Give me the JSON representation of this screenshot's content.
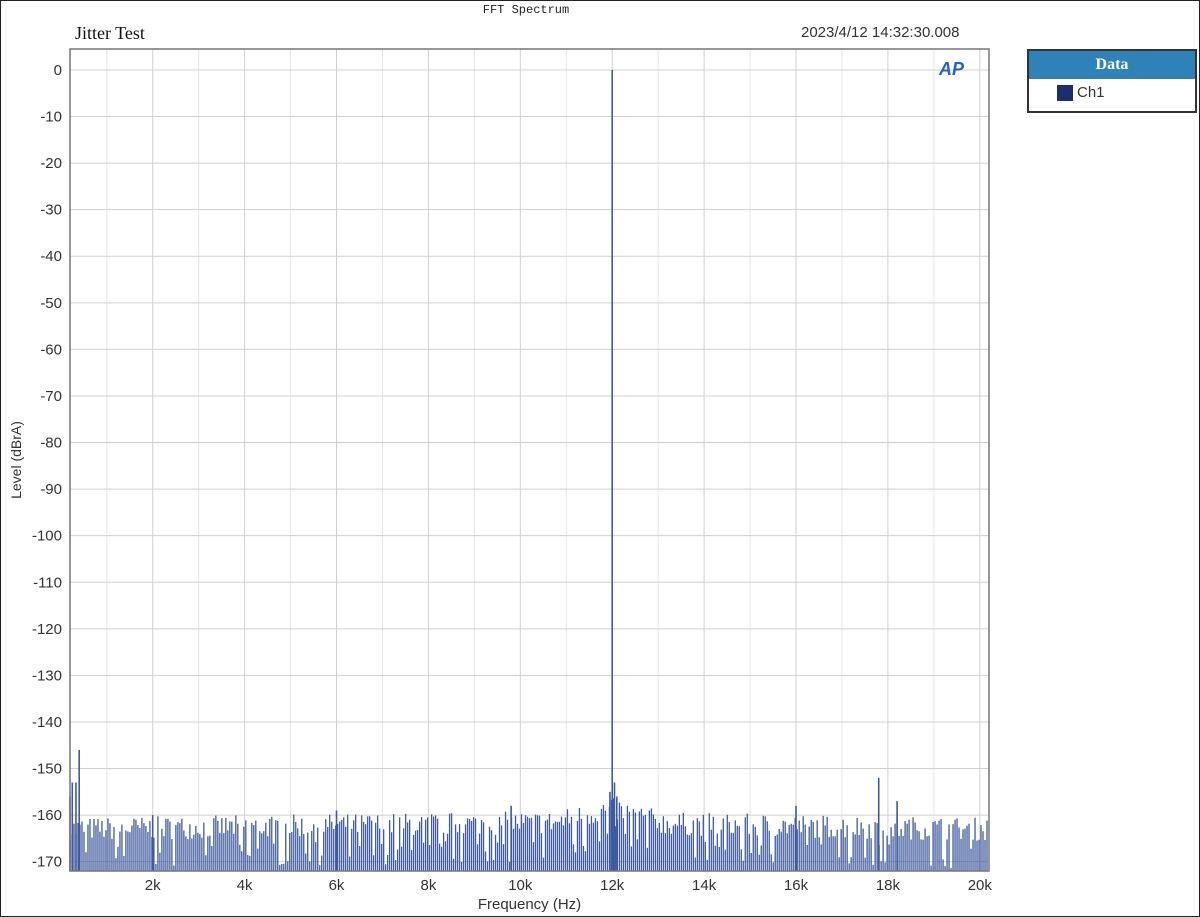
{
  "chart_data": {
    "type": "bar",
    "figure_title": "FFT Spectrum",
    "title": "Jitter Test",
    "timestamp": "2023/4/12 14:32:30.008",
    "xlabel": "Frequency (Hz)",
    "ylabel": "Level (dBrA)",
    "xlim": [
      200,
      20200
    ],
    "ylim": [
      -172,
      4.5
    ],
    "xticks": [
      {
        "v": 2000,
        "label": "2k"
      },
      {
        "v": 4000,
        "label": "4k"
      },
      {
        "v": 6000,
        "label": "6k"
      },
      {
        "v": 8000,
        "label": "8k"
      },
      {
        "v": 10000,
        "label": "10k"
      },
      {
        "v": 12000,
        "label": "12k"
      },
      {
        "v": 14000,
        "label": "14k"
      },
      {
        "v": 16000,
        "label": "16k"
      },
      {
        "v": 18000,
        "label": "18k"
      },
      {
        "v": 20000,
        "label": "20k"
      }
    ],
    "yticks": [
      0,
      -10,
      -20,
      -30,
      -40,
      -50,
      -60,
      -70,
      -80,
      -90,
      -100,
      -110,
      -120,
      -130,
      -140,
      -150,
      -160,
      -170
    ],
    "grid": true,
    "series": [
      {
        "name": "Ch1",
        "color": "#3f5a9e",
        "noise_floor": {
          "level": -163,
          "spread": 2.5,
          "bins": 460
        },
        "peaks": [
          {
            "x": 200,
            "y": -156
          },
          {
            "x": 250,
            "y": -153
          },
          {
            "x": 330,
            "y": -153
          },
          {
            "x": 400,
            "y": -146
          },
          {
            "x": 2000,
            "y": -160
          },
          {
            "x": 6000,
            "y": -159
          },
          {
            "x": 9800,
            "y": -158
          },
          {
            "x": 11950,
            "y": -155
          },
          {
            "x": 12000,
            "y": 0
          },
          {
            "x": 12050,
            "y": -153
          },
          {
            "x": 12100,
            "y": -156
          },
          {
            "x": 16000,
            "y": -158
          },
          {
            "x": 17800,
            "y": -152
          },
          {
            "x": 18200,
            "y": -157
          }
        ]
      }
    ],
    "legend": {
      "title": "Data",
      "placement": "right"
    }
  },
  "logo": "AP"
}
